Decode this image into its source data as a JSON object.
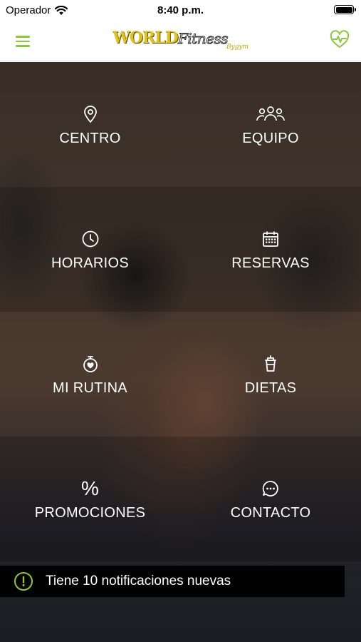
{
  "status_bar": {
    "carrier": "Operador",
    "time": "8:40 p.m."
  },
  "nav": {
    "logo_line1": "WORLD",
    "logo_line2": "Fitness",
    "logo_line3": "Bygym",
    "menu_icon": "hamburger-menu-icon",
    "health_icon": "heart-pulse-icon",
    "accent_color": "#8dc63f"
  },
  "menu": {
    "centro": "CENTRO",
    "equipo": "EQUIPO",
    "horarios": "HORARIOS",
    "reservas": "RESERVAS",
    "mi_rutina": "MI RUTINA",
    "dietas": "DIETAS",
    "promociones": "PROMOCIONES",
    "promociones_symbol": "%",
    "contacto": "CONTACTO"
  },
  "notification": {
    "text": "Tiene 10 notificaciones nuevas",
    "icon": "alert-circle-icon"
  }
}
